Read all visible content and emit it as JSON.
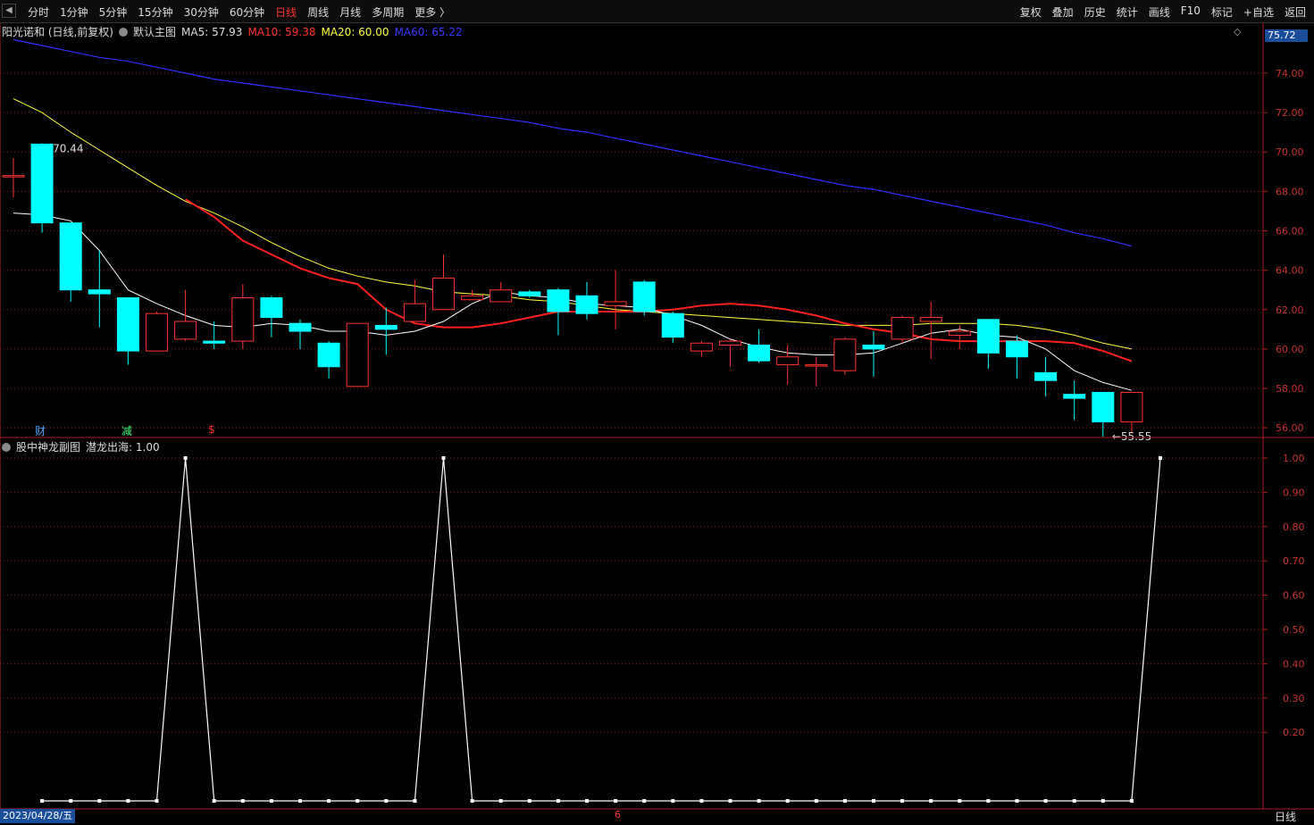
{
  "toolbar": {
    "left": [
      "分时",
      "1分钟",
      "5分钟",
      "15分钟",
      "30分钟",
      "60分钟",
      "日线",
      "周线",
      "月线",
      "多周期",
      "更多 〉"
    ],
    "active_index": 6,
    "right": [
      "复权",
      "叠加",
      "历史",
      "统计",
      "画线",
      "F10",
      "标记",
      "+自选",
      "返回"
    ]
  },
  "info": {
    "stock": "阳光诺和 (日线,前复权)",
    "main_chart": "默认主图",
    "ma5": "MA5: 57.93",
    "ma10": "MA10: 59.38",
    "ma20": "MA20: 60.00",
    "ma60": "MA60: 65.22"
  },
  "sub_info": {
    "name": "股中神龙副图",
    "indicator": "潜龙出海: 1.00"
  },
  "bottom": {
    "date": "2023/04/28/五",
    "month_mark": "6",
    "period": "日线"
  },
  "price_box": "75.72",
  "markers": {
    "m1": "财",
    "m2": "减",
    "m3": "$"
  },
  "colors": {
    "up": "#ff3232",
    "down": "#00ffff",
    "ma5": "#ffffff",
    "ma10": "#ff2020",
    "ma20": "#ffff40",
    "ma60": "#3030ff"
  },
  "chart_data": [
    {
      "type": "candlestick",
      "y_ticks": [
        56,
        58,
        60,
        62,
        64,
        66,
        68,
        70,
        72,
        74
      ],
      "ylim": [
        55.6,
        75.9
      ],
      "annotations": {
        "high": "70.44",
        "low": "55.55"
      },
      "candles": [
        {
          "o": 68.8,
          "c": 68.8,
          "h": 69.7,
          "l": 67.7
        },
        {
          "o": 70.4,
          "c": 66.4,
          "h": 70.44,
          "l": 65.9
        },
        {
          "o": 66.4,
          "c": 63.0,
          "h": 66.3,
          "l": 62.4
        },
        {
          "o": 63.0,
          "c": 62.8,
          "h": 65.0,
          "l": 61.1
        },
        {
          "o": 62.6,
          "c": 59.9,
          "h": 62.6,
          "l": 59.2
        },
        {
          "o": 59.9,
          "c": 61.8,
          "h": 61.9,
          "l": 59.9
        },
        {
          "o": 60.5,
          "c": 61.4,
          "h": 63.0,
          "l": 60.4
        },
        {
          "o": 60.4,
          "c": 60.3,
          "h": 61.4,
          "l": 60.0
        },
        {
          "o": 60.4,
          "c": 62.6,
          "h": 63.3,
          "l": 60.0
        },
        {
          "o": 62.6,
          "c": 61.6,
          "h": 62.7,
          "l": 60.6
        },
        {
          "o": 61.3,
          "c": 60.9,
          "h": 61.5,
          "l": 60.0
        },
        {
          "o": 60.3,
          "c": 59.1,
          "h": 60.4,
          "l": 58.5
        },
        {
          "o": 58.1,
          "c": 61.3,
          "h": 61.3,
          "l": 58.1
        },
        {
          "o": 61.2,
          "c": 61.0,
          "h": 62.1,
          "l": 59.7
        },
        {
          "o": 61.4,
          "c": 62.3,
          "h": 63.5,
          "l": 61.4
        },
        {
          "o": 62.0,
          "c": 63.6,
          "h": 64.8,
          "l": 62.0
        },
        {
          "o": 62.5,
          "c": 62.7,
          "h": 63.0,
          "l": 62.5
        },
        {
          "o": 62.4,
          "c": 63.0,
          "h": 63.4,
          "l": 62.4
        },
        {
          "o": 62.9,
          "c": 62.7,
          "h": 63.0,
          "l": 62.6
        },
        {
          "o": 63.0,
          "c": 61.9,
          "h": 63.1,
          "l": 60.7
        },
        {
          "o": 62.7,
          "c": 61.8,
          "h": 63.4,
          "l": 61.5
        },
        {
          "o": 62.2,
          "c": 62.4,
          "h": 64.0,
          "l": 61.0
        },
        {
          "o": 63.4,
          "c": 61.9,
          "h": 63.5,
          "l": 61.7
        },
        {
          "o": 61.8,
          "c": 60.6,
          "h": 61.9,
          "l": 60.3
        },
        {
          "o": 59.9,
          "c": 60.3,
          "h": 60.4,
          "l": 59.6
        },
        {
          "o": 60.2,
          "c": 60.4,
          "h": 60.5,
          "l": 59.1
        },
        {
          "o": 60.2,
          "c": 59.4,
          "h": 61.0,
          "l": 59.3
        },
        {
          "o": 59.2,
          "c": 59.6,
          "h": 60.2,
          "l": 58.2
        },
        {
          "o": 59.2,
          "c": 59.2,
          "h": 59.6,
          "l": 58.1
        },
        {
          "o": 58.9,
          "c": 60.5,
          "h": 60.6,
          "l": 58.7
        },
        {
          "o": 60.2,
          "c": 60.0,
          "h": 60.9,
          "l": 58.6
        },
        {
          "o": 60.5,
          "c": 61.6,
          "h": 61.7,
          "l": 60.3
        },
        {
          "o": 61.4,
          "c": 61.6,
          "h": 62.4,
          "l": 59.5
        },
        {
          "o": 60.7,
          "c": 60.9,
          "h": 61.2,
          "l": 60.0
        },
        {
          "o": 61.5,
          "c": 59.8,
          "h": 61.5,
          "l": 59.0
        },
        {
          "o": 60.4,
          "c": 59.6,
          "h": 60.7,
          "l": 58.5
        },
        {
          "o": 58.8,
          "c": 58.4,
          "h": 59.6,
          "l": 57.6
        },
        {
          "o": 57.7,
          "c": 57.5,
          "h": 58.4,
          "l": 56.4
        },
        {
          "o": 57.8,
          "c": 56.3,
          "h": 57.8,
          "l": 55.55
        },
        {
          "o": 56.3,
          "c": 57.8,
          "h": 57.8,
          "l": 55.7
        }
      ],
      "ma5": [
        66.9,
        66.8,
        66.5,
        65.0,
        63.0,
        62.3,
        61.7,
        61.2,
        61.1,
        61.3,
        61.2,
        60.9,
        60.9,
        60.7,
        60.9,
        61.4,
        62.3,
        62.9,
        62.7,
        62.6,
        62.3,
        62.2,
        62.1,
        61.7,
        61.2,
        60.5,
        60.1,
        59.8,
        59.7,
        59.7,
        59.8,
        60.3,
        60.8,
        61.0,
        60.7,
        60.6,
        60.0,
        58.9,
        58.3,
        57.9
      ],
      "ma10": [
        null,
        null,
        null,
        null,
        null,
        null,
        67.6,
        66.7,
        65.5,
        64.8,
        64.1,
        63.6,
        63.3,
        62.0,
        61.3,
        61.1,
        61.1,
        61.3,
        61.6,
        61.9,
        61.9,
        61.9,
        61.9,
        62.0,
        62.2,
        62.3,
        62.2,
        62.0,
        61.7,
        61.3,
        61.0,
        60.8,
        60.5,
        60.4,
        60.4,
        60.4,
        60.4,
        60.3,
        59.9,
        59.38
      ],
      "ma20": [
        72.7,
        72.0,
        71.0,
        70.1,
        69.2,
        68.3,
        67.5,
        66.9,
        66.2,
        65.4,
        64.7,
        64.1,
        63.7,
        63.4,
        63.2,
        62.9,
        62.8,
        62.7,
        62.5,
        62.4,
        62.2,
        62.0,
        61.9,
        61.8,
        61.7,
        61.6,
        61.5,
        61.4,
        61.3,
        61.2,
        61.2,
        61.2,
        61.3,
        61.3,
        61.3,
        61.2,
        61.0,
        60.7,
        60.3,
        60.0
      ],
      "ma60": [
        75.7,
        75.4,
        75.1,
        74.8,
        74.6,
        74.3,
        74.0,
        73.7,
        73.5,
        73.3,
        73.1,
        72.9,
        72.7,
        72.5,
        72.3,
        72.1,
        71.9,
        71.7,
        71.5,
        71.2,
        71.0,
        70.7,
        70.4,
        70.1,
        69.8,
        69.5,
        69.2,
        68.9,
        68.6,
        68.3,
        68.1,
        67.8,
        67.5,
        67.2,
        66.9,
        66.6,
        66.3,
        65.9,
        65.6,
        65.22
      ]
    },
    {
      "type": "line",
      "y_ticks": [
        0.2,
        0.3,
        0.4,
        0.5,
        0.6,
        0.7,
        0.8,
        0.9,
        1.0
      ],
      "ylim": [
        0,
        1.0
      ],
      "values": [
        0,
        0,
        0,
        0,
        0,
        1,
        0,
        0,
        0,
        0,
        0,
        0,
        0,
        0,
        1,
        0,
        0,
        0,
        0,
        0,
        0,
        0,
        0,
        0,
        0,
        0,
        0,
        0,
        0,
        0,
        0,
        0,
        0,
        0,
        0,
        0,
        0,
        0,
        0,
        1
      ]
    }
  ]
}
